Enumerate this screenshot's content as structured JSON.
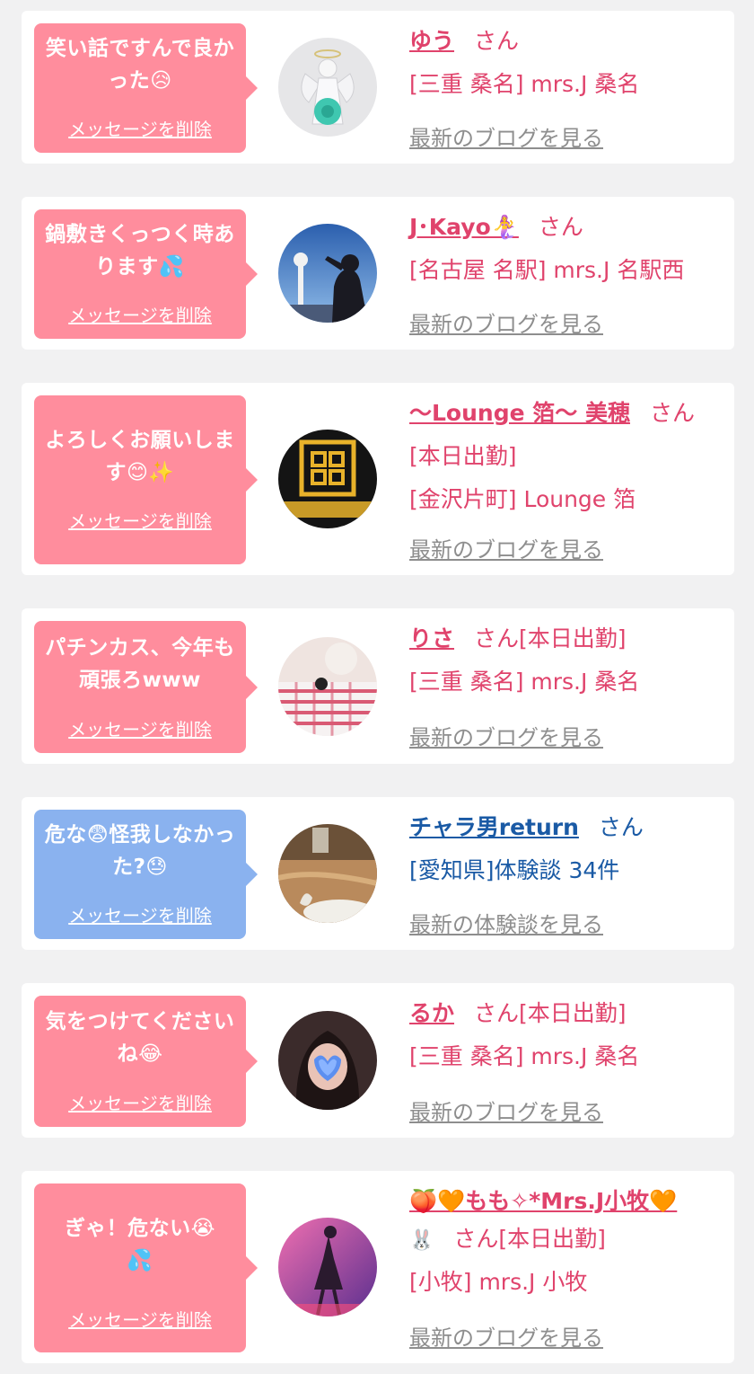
{
  "delete_label": "メッセージを削除",
  "items": [
    {
      "message": "笑い話ですんで良かった😥",
      "name": "ゆう",
      "honorific": "さん",
      "status": "",
      "lines": [
        "[三重 桑名] mrs.J 桑名"
      ],
      "link": "最新のブログを見る",
      "bubble_color": "#ff8d9d"
    },
    {
      "message": "鍋敷きくっつく時あります💦",
      "name": "J･Kayo🧜‍♀️",
      "honorific": "さん",
      "status": "",
      "lines": [
        "[名古屋 名駅] mrs.J 名駅西"
      ],
      "link": "最新のブログを見る",
      "bubble_color": "#ff8d9d"
    },
    {
      "message": "よろしくお願いします😊✨",
      "name": "〜Lounge 箔〜 美穂",
      "honorific": "さん",
      "status": "",
      "lines": [
        "[本日出勤]",
        "[金沢片町] Lounge 箔"
      ],
      "link": "最新のブログを見る",
      "bubble_color": "#ff8d9d"
    },
    {
      "message": "パチンカス、今年も頑張ろwww",
      "name": "りさ",
      "honorific": "さん",
      "status": "[本日出勤]",
      "lines": [
        "[三重 桑名] mrs.J 桑名"
      ],
      "link": "最新のブログを見る",
      "bubble_color": "#ff8d9d"
    },
    {
      "message": "危な😨怪我しなかった?😓",
      "name": "チャラ男return",
      "honorific": "さん",
      "status": "",
      "lines": [
        "[愛知県]体験談 34件"
      ],
      "link": "最新の体験談を見る",
      "bubble_color": "#8ab2ef"
    },
    {
      "message": "気をつけてくださいね😂",
      "name": "るか",
      "honorific": "さん",
      "status": "[本日出勤]",
      "lines": [
        "[三重 桑名] mrs.J 桑名"
      ],
      "link": "最新のブログを見る",
      "bubble_color": "#ff8d9d"
    },
    {
      "message": "ぎゃ！危ない😭💦",
      "name": "🍑🧡もも✧*Mrs.J小牧🧡",
      "name_suffix": "🐰",
      "honorific": "さん",
      "status": "[本日出勤]",
      "lines": [
        "[小牧] mrs.J 小牧"
      ],
      "link": "最新のブログを見る",
      "bubble_color": "#ff8d9d"
    }
  ]
}
